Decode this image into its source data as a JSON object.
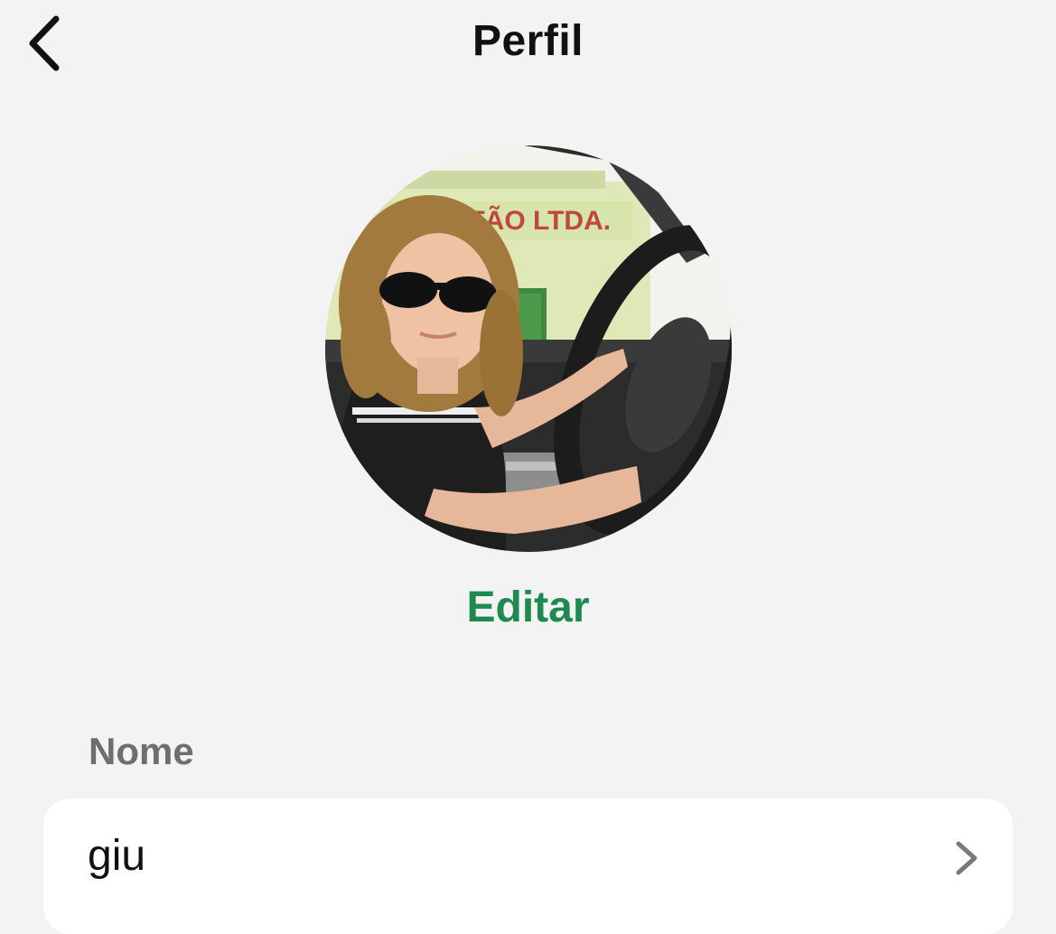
{
  "header": {
    "title": "Perfil",
    "back_icon": "chevron-left-icon"
  },
  "profile": {
    "avatar_description": "photo of a child in sunglasses holding a steering wheel",
    "edit_label": "Editar"
  },
  "fields": {
    "name_label": "Nome",
    "name_value": "giu",
    "row_icon": "chevron-right-icon"
  },
  "colors": {
    "background": "#f3f3f3",
    "accent": "#1e8a52",
    "label": "#6e6e6e",
    "card": "#ffffff"
  }
}
